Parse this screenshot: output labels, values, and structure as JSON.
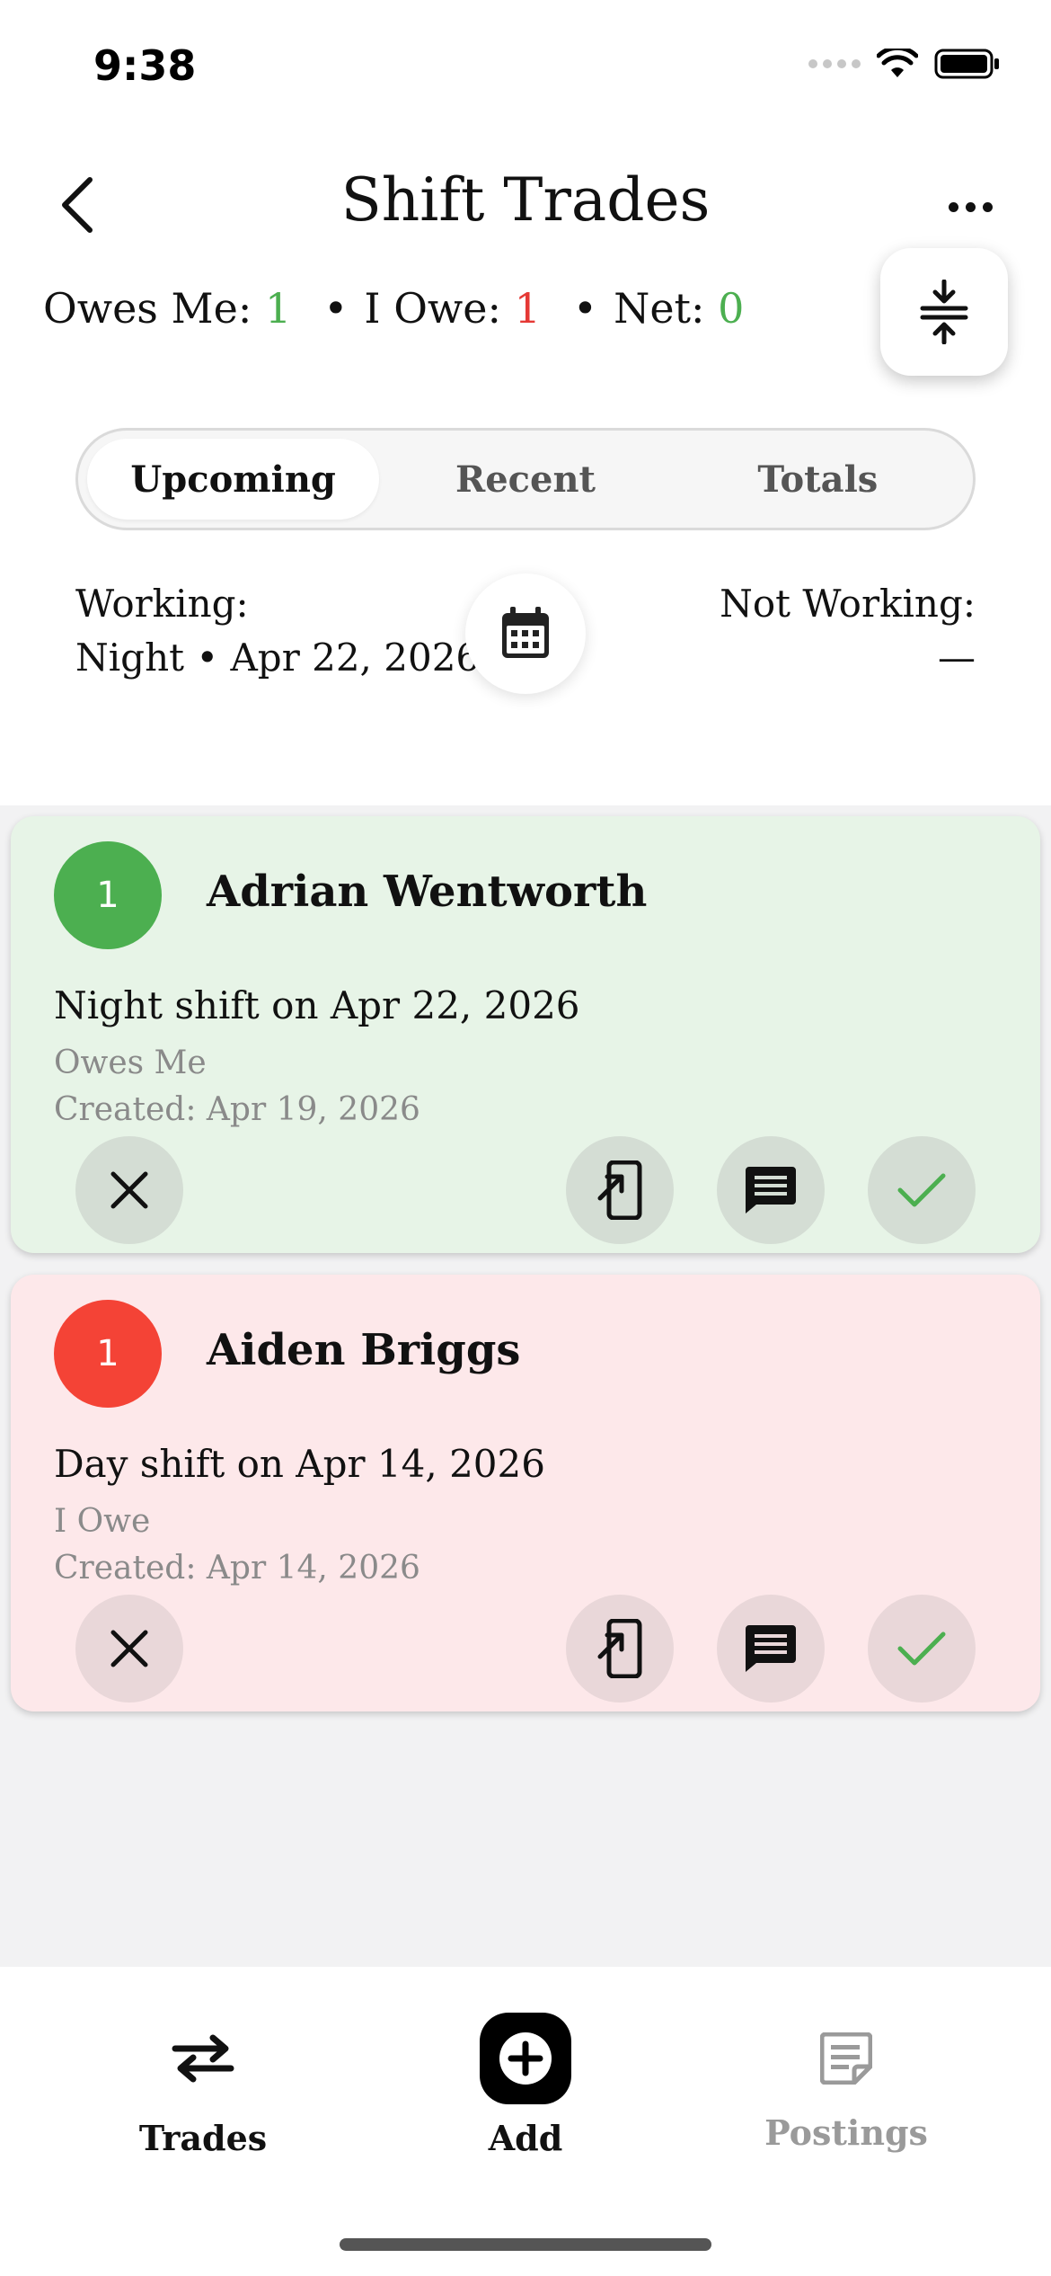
{
  "status_bar": {
    "time": "9:38"
  },
  "header": {
    "title": "Shift Trades"
  },
  "summary": {
    "owes_me_label": "Owes Me:",
    "owes_me_value": "1",
    "i_owe_label": "I Owe:",
    "i_owe_value": "1",
    "net_label": "Net:",
    "net_value": "0",
    "separator": "•"
  },
  "segments": [
    {
      "label": "Upcoming",
      "active": true
    },
    {
      "label": "Recent",
      "active": false
    },
    {
      "label": "Totals",
      "active": false
    }
  ],
  "working": {
    "label": "Working:",
    "value": "Night • Apr 22, 2026"
  },
  "not_working": {
    "label": "Not Working:",
    "value": "—"
  },
  "trades": [
    {
      "count": "1",
      "name": "Adrian Wentworth",
      "shift": "Night shift on Apr 22, 2026",
      "type": "Owes Me",
      "created": "Created: Apr 19, 2026",
      "color": "#4caf50",
      "background": "#e7f4e7"
    },
    {
      "count": "1",
      "name": "Aiden Briggs",
      "shift": "Day shift on Apr 14, 2026",
      "type": "I Owe",
      "created": "Created: Apr 14, 2026",
      "color": "#f44336",
      "background": "#fde8ea"
    }
  ],
  "tab_bar": {
    "trades_label": "Trades",
    "add_label": "Add",
    "postings_label": "Postings"
  },
  "icons": {
    "back": "chevron-left-icon",
    "more": "more-horizontal-icon",
    "compact": "compress-vertical-icon",
    "calendar": "calendar-icon",
    "reject": "close-icon",
    "device": "device-transfer-icon",
    "message": "message-icon",
    "accept": "check-icon",
    "trades": "swap-arrows-icon",
    "add": "plus-circle-icon",
    "postings": "note-icon"
  },
  "colors": {
    "positive": "#4caf50",
    "negative": "#e53935",
    "muted": "#8a8a8a"
  }
}
